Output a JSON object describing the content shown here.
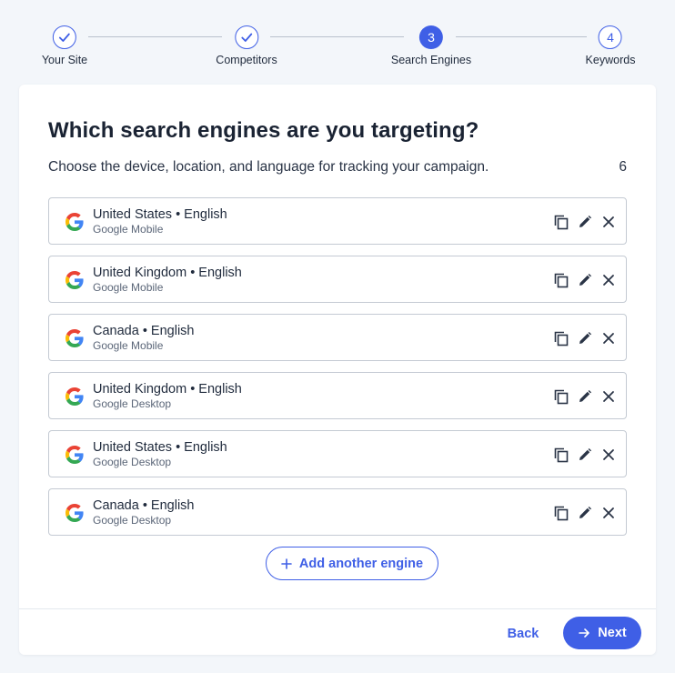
{
  "stepper": {
    "steps": [
      {
        "label": "Your Site",
        "state": "done",
        "number": "1"
      },
      {
        "label": "Competitors",
        "state": "done",
        "number": "2"
      },
      {
        "label": "Search Engines",
        "state": "active",
        "number": "3"
      },
      {
        "label": "Keywords",
        "state": "pending",
        "number": "4"
      }
    ]
  },
  "header": {
    "title": "Which search engines are you targeting?",
    "subtitle": "Choose the device, location, and language for tracking your campaign.",
    "count": "6"
  },
  "engines": [
    {
      "location_language": "United States • English",
      "engine": "Google Mobile"
    },
    {
      "location_language": "United Kingdom • English",
      "engine": "Google Mobile"
    },
    {
      "location_language": "Canada • English",
      "engine": "Google Mobile"
    },
    {
      "location_language": "United Kingdom • English",
      "engine": "Google Desktop"
    },
    {
      "location_language": "United States • English",
      "engine": "Google Desktop"
    },
    {
      "location_language": "Canada • English",
      "engine": "Google Desktop"
    }
  ],
  "actions": {
    "add_label": "Add another engine",
    "back_label": "Back",
    "next_label": "Next"
  },
  "icons": {
    "engine_logo": "google-logo-icon",
    "duplicate": "copy-icon",
    "edit": "pencil-icon",
    "remove": "close-icon",
    "add": "plus-icon",
    "next": "arrow-right-icon",
    "step_done": "check-icon"
  },
  "colors": {
    "accent": "#3f5fe6",
    "background": "#f3f6fa",
    "card": "#ffffff",
    "border": "#c4cad3"
  }
}
